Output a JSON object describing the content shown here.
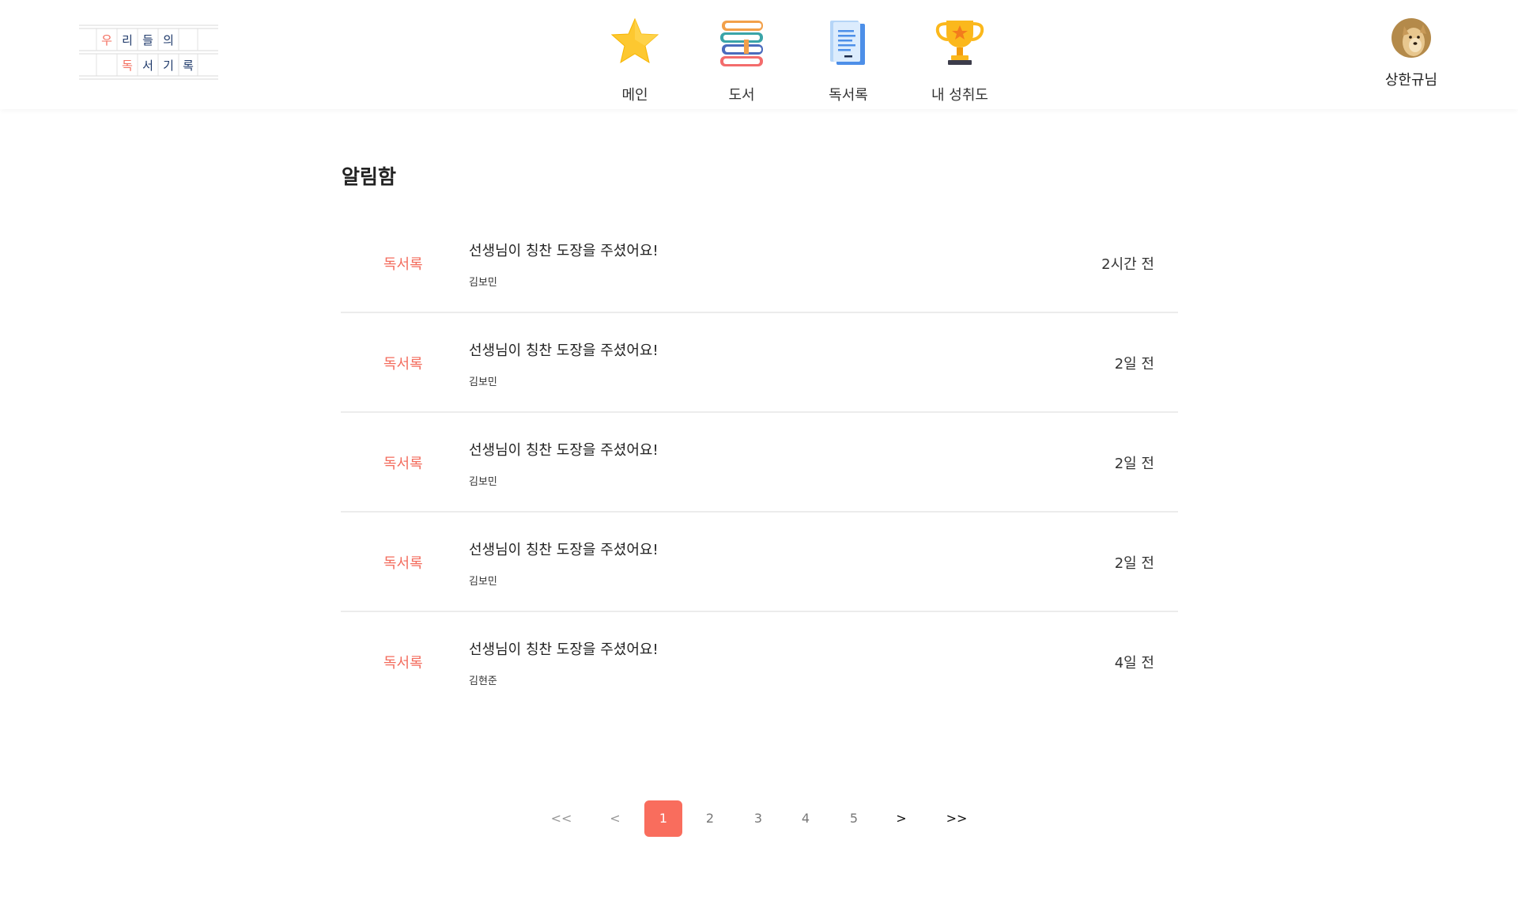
{
  "logo": {
    "line1": [
      "우",
      "리",
      "들",
      "의"
    ],
    "line2": [
      "독",
      "서",
      "기",
      "록"
    ],
    "colors": {
      "red": "#f36c5d",
      "navy": "#1f3a6b"
    }
  },
  "nav": [
    {
      "label": "메인",
      "icon": "star-icon"
    },
    {
      "label": "도서",
      "icon": "books-icon"
    },
    {
      "label": "독서록",
      "icon": "document-icon"
    },
    {
      "label": "내 성취도",
      "icon": "trophy-icon"
    }
  ],
  "profile": {
    "name": "상한규님",
    "icon": "avatar-dog"
  },
  "page": {
    "title": "알림함"
  },
  "notifications": [
    {
      "category": "독서록",
      "message": "선생님이 칭찬 도장을 주셨어요!",
      "sender": "김보민",
      "time": "2시간 전"
    },
    {
      "category": "독서록",
      "message": "선생님이 칭찬 도장을 주셨어요!",
      "sender": "김보민",
      "time": "2일 전"
    },
    {
      "category": "독서록",
      "message": "선생님이 칭찬 도장을 주셨어요!",
      "sender": "김보민",
      "time": "2일 전"
    },
    {
      "category": "독서록",
      "message": "선생님이 칭찬 도장을 주셨어요!",
      "sender": "김보민",
      "time": "2일 전"
    },
    {
      "category": "독서록",
      "message": "선생님이 칭찬 도장을 주셨어요!",
      "sender": "김현준",
      "time": "4일 전"
    }
  ],
  "pagination": {
    "first": "<<",
    "prev": "<",
    "pages": [
      "1",
      "2",
      "3",
      "4",
      "5"
    ],
    "current": "1",
    "next": ">",
    "last": ">>"
  },
  "colors": {
    "accent": "#f96d5d",
    "divider": "#ececec"
  }
}
